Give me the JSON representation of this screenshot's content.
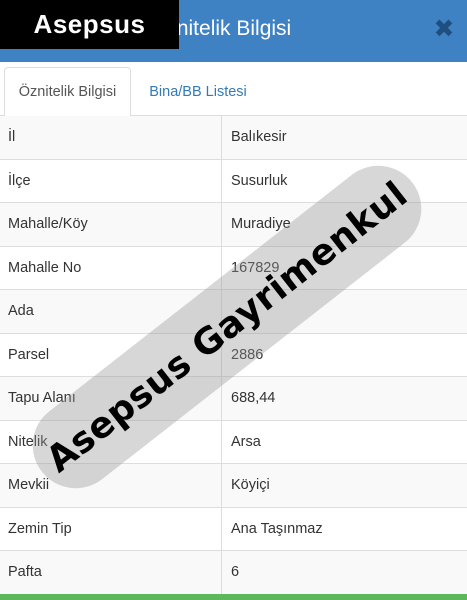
{
  "header": {
    "title": "Öznitelik Bilgisi",
    "close_icon": "close-icon",
    "close_glyph": "✖",
    "accent_color": "#3e82c4"
  },
  "brand": {
    "label": "Asepsus"
  },
  "tabs": [
    {
      "label": "Öznitelik Bilgisi",
      "active": true
    },
    {
      "label": "Bina/BB Listesi",
      "active": false
    }
  ],
  "rows": [
    {
      "label": "İl",
      "value": "Balıkesir"
    },
    {
      "label": "İlçe",
      "value": "Susurluk"
    },
    {
      "label": "Mahalle/Köy",
      "value": "Muradiye"
    },
    {
      "label": "Mahalle No",
      "value": "167829"
    },
    {
      "label": "Ada",
      "value": ""
    },
    {
      "label": "Parsel",
      "value": "2886"
    },
    {
      "label": "Tapu Alanı",
      "value": "688,44"
    },
    {
      "label": "Nitelik",
      "value": "Arsa"
    },
    {
      "label": "Mevkii",
      "value": "Köyiçi"
    },
    {
      "label": "Zemin Tip",
      "value": "Ana Taşınmaz"
    },
    {
      "label": "Pafta",
      "value": "6"
    }
  ],
  "watermark": {
    "text": "Asepsus Gayrimenkul"
  },
  "footer": {
    "bar_color": "#5cb85c"
  }
}
